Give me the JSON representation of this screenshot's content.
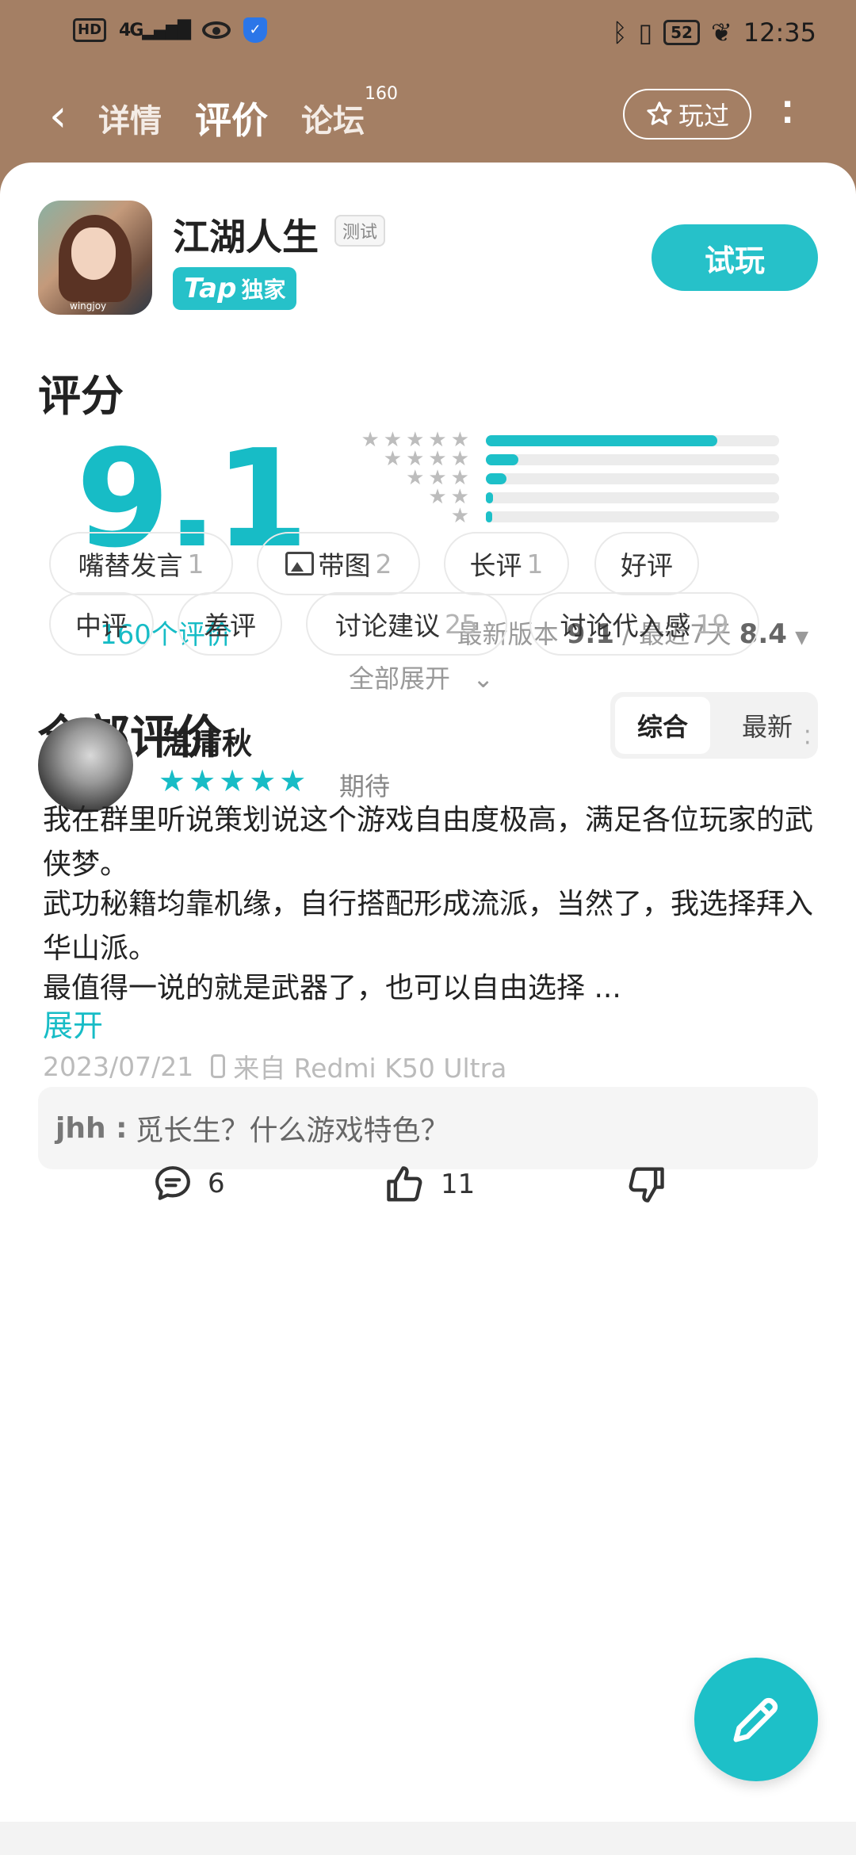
{
  "status_bar": {
    "hd": "HD",
    "signal": "4G",
    "battery": "52",
    "time": "12:35"
  },
  "nav": {
    "back_label": "‹",
    "tabs": [
      {
        "label": "详情"
      },
      {
        "label": "评价"
      },
      {
        "label": "论坛"
      }
    ],
    "active_tab_badge": "160",
    "played_label": "玩过"
  },
  "app": {
    "name": "江湖人生",
    "test_badge": "测试",
    "tap_logo": "Tap",
    "tap_exclusive": "独家",
    "icon_watermark": "wingjoy",
    "try_button": "试玩"
  },
  "score": {
    "heading": "评分",
    "value": "9.1",
    "count_label": "160个评价",
    "distribution": [
      {
        "stars": 5,
        "fraction": 0.79
      },
      {
        "stars": 4,
        "fraction": 0.11
      },
      {
        "stars": 3,
        "fraction": 0.07
      },
      {
        "stars": 2,
        "fraction": 0.025
      },
      {
        "stars": 1,
        "fraction": 0.015
      }
    ],
    "latest_version_label": "最新版本",
    "latest_version_score": "9.1",
    "separator": "/",
    "recent_label": "最近7天",
    "recent_score": "8.4"
  },
  "reviews": {
    "heading": "全部评价",
    "sort_options": [
      "综合",
      "最新"
    ],
    "selected_sort": "综合",
    "chips": [
      {
        "label": "嘴替发言",
        "count": "1"
      },
      {
        "label": "带图",
        "count": "2",
        "icon": "image-icon"
      },
      {
        "label": "长评",
        "count": "1"
      },
      {
        "label": "好评",
        "count": ""
      },
      {
        "label": "中评",
        "count": ""
      },
      {
        "label": "差评",
        "count": ""
      },
      {
        "label": "讨论建议",
        "count": "25"
      },
      {
        "label": "讨论代入感",
        "count": "19"
      }
    ],
    "expand_all": "全部展开"
  },
  "review": {
    "user": "湛清秋",
    "rating_stars": 5,
    "tag": "期待",
    "paragraphs": [
      "我在群里听说策划说这个游戏自由度极高，满足各位玩家的武侠梦。",
      "武功秘籍均靠机缘，自行搭配形成流派，当然了，我选择拜入华山派。",
      "最值得一说的就是武器了，也可以自由选择 ..."
    ],
    "expand": "展开",
    "date": "2023/07/21",
    "device": "来自 Redmi K50 Ultra",
    "reply_user": "jhh :",
    "reply_text": "觅长生？什么游戏特色？",
    "comments": "6",
    "likes": "11"
  },
  "colors": {
    "accent": "#1dc0c8",
    "header_bg": "#a47f64"
  }
}
